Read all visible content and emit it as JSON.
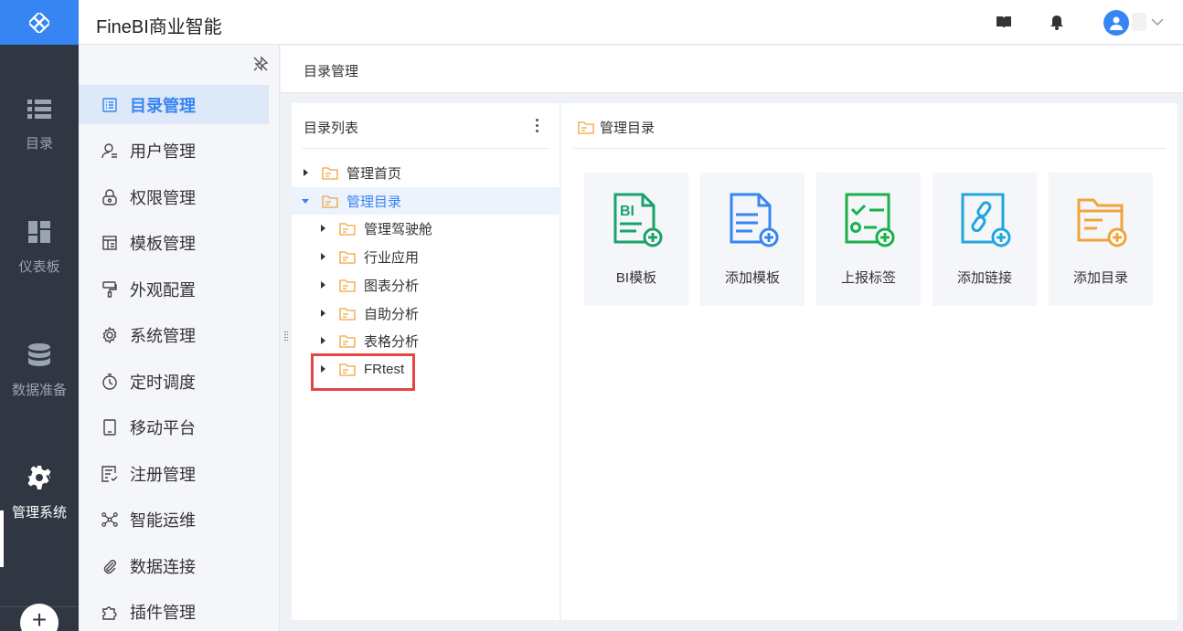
{
  "app": {
    "title": "FineBI商业智能"
  },
  "rail": {
    "items": [
      {
        "label": "目录",
        "icon": "list-icon"
      },
      {
        "label": "仪表板",
        "icon": "dashboard-icon"
      },
      {
        "label": "数据准备",
        "icon": "database-icon"
      },
      {
        "label": "管理系统",
        "icon": "gear-icon",
        "active": true
      }
    ]
  },
  "submenu": {
    "items": [
      {
        "label": "目录管理",
        "icon": "catalog-icon",
        "active": true
      },
      {
        "label": "用户管理",
        "icon": "user-icon"
      },
      {
        "label": "权限管理",
        "icon": "lock-icon"
      },
      {
        "label": "模板管理",
        "icon": "template-icon"
      },
      {
        "label": "外观配置",
        "icon": "brush-icon"
      },
      {
        "label": "系统管理",
        "icon": "gear-icon"
      },
      {
        "label": "定时调度",
        "icon": "timer-icon"
      },
      {
        "label": "移动平台",
        "icon": "mobile-icon"
      },
      {
        "label": "注册管理",
        "icon": "register-icon"
      },
      {
        "label": "智能运维",
        "icon": "network-icon"
      },
      {
        "label": "数据连接",
        "icon": "paperclip-icon"
      },
      {
        "label": "插件管理",
        "icon": "puzzle-icon"
      }
    ]
  },
  "breadcrumb": "目录管理",
  "catalog": {
    "title": "目录列表",
    "tree": [
      {
        "label": "管理首页",
        "level": 0,
        "expanded": false
      },
      {
        "label": "管理目录",
        "level": 0,
        "expanded": true,
        "selected": true
      },
      {
        "label": "管理驾驶舱",
        "level": 1,
        "expanded": false
      },
      {
        "label": "行业应用",
        "level": 1,
        "expanded": false
      },
      {
        "label": "图表分析",
        "level": 1,
        "expanded": false
      },
      {
        "label": "自助分析",
        "level": 1,
        "expanded": false
      },
      {
        "label": "表格分析",
        "level": 1,
        "expanded": false
      },
      {
        "label": "FRtest",
        "level": 1,
        "expanded": false,
        "highlighted": true
      }
    ]
  },
  "manage": {
    "title": "管理目录",
    "cards": [
      {
        "label": "BI模板",
        "icon": "bi-template-icon",
        "color": "#1aa36b"
      },
      {
        "label": "添加模板",
        "icon": "add-template-icon",
        "color": "#3685f2"
      },
      {
        "label": "上报标签",
        "icon": "report-tag-icon",
        "color": "#1ab04a"
      },
      {
        "label": "添加链接",
        "icon": "add-link-icon",
        "color": "#22a6e0"
      },
      {
        "label": "添加目录",
        "icon": "add-folder-icon",
        "color": "#f0a43a"
      }
    ]
  },
  "colors": {
    "accent": "#3685f2",
    "rail_bg": "#303743",
    "highlight": "#e54545"
  }
}
